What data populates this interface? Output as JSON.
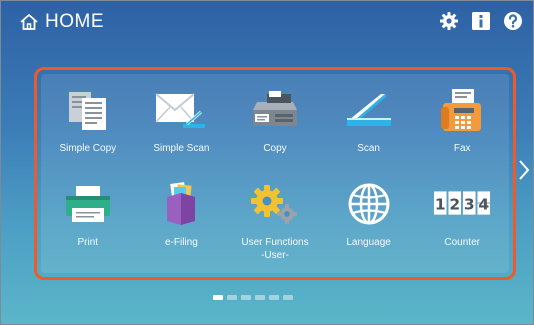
{
  "header": {
    "title": "HOME",
    "icons": [
      "settings-gear-icon",
      "info-icon",
      "help-icon"
    ]
  },
  "tiles": [
    {
      "label": "Simple Copy",
      "icon": "simple-copy-icon"
    },
    {
      "label": "Simple Scan",
      "icon": "simple-scan-icon"
    },
    {
      "label": "Copy",
      "icon": "copy-icon"
    },
    {
      "label": "Scan",
      "icon": "scan-icon"
    },
    {
      "label": "Fax",
      "icon": "fax-icon"
    },
    {
      "label": "Print",
      "icon": "print-icon"
    },
    {
      "label": "e-Filing",
      "icon": "e-filing-icon"
    },
    {
      "label": "User Functions\n-User-",
      "icon": "user-functions-icon"
    },
    {
      "label": "Language",
      "icon": "language-globe-icon"
    },
    {
      "label": "Counter",
      "icon": "counter-icon"
    }
  ],
  "counter_digits": [
    "1",
    "2",
    "3",
    "4"
  ],
  "pager": {
    "pages": 6,
    "current": 1
  },
  "colors": {
    "highlight_border": "#f05a28",
    "background_top": "#2e61a4",
    "background_bottom": "#5bb6c9"
  }
}
